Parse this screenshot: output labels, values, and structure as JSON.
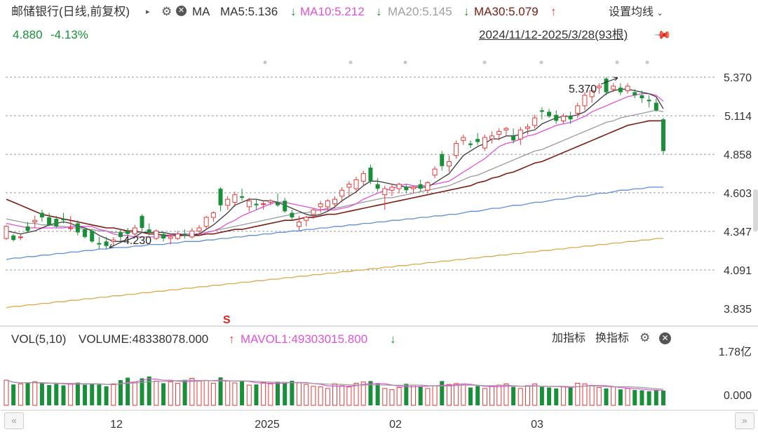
{
  "header": {
    "stock_name": "邮储银行",
    "period_mode": "(日线,前复权)",
    "ma_label": "MA",
    "ma5": "MA5:5.136",
    "ma10": "MA10:5.212",
    "ma20": "MA20:5.145",
    "ma30": "MA30:5.079",
    "settings_label": "设置均线",
    "price": "4.880",
    "change_pct": "-4.13%",
    "range_label": "2024/11/12-2025/3/28(93根)"
  },
  "volume_header": {
    "vol_label": "VOL(5,10)",
    "volume": "VOLUME:48338078.000",
    "mavol": "MAVOL1:49303015.800",
    "add_indicator": "加指标",
    "switch_indicator": "换指标"
  },
  "colors": {
    "up": "#e23a3a",
    "down": "#1a8f3a",
    "ma5": "#3a3a3a",
    "ma10": "#e052d6",
    "ma20": "#9a9a9a",
    "ma30": "#7a1a12",
    "ma60": "#5b8fd6",
    "ma120": "#d9a84a"
  },
  "chart_data": {
    "type": "candlestick",
    "price_axis_ticks": [
      "5.370",
      "5.114",
      "4.858",
      "4.603",
      "4.347",
      "4.091",
      "3.835"
    ],
    "price_range": [
      3.835,
      5.37
    ],
    "volume_axis_ticks": [
      "1.78亿",
      "0.000"
    ],
    "volume_max": 178000000,
    "x_labels": [
      "12",
      "2025",
      "02",
      "03"
    ],
    "annotations": {
      "high": "5.370",
      "low": "4.230"
    },
    "candles": [
      [
        4.3,
        4.39,
        4.29,
        4.38
      ],
      [
        4.32,
        4.33,
        4.28,
        4.29
      ],
      [
        4.31,
        4.33,
        4.29,
        4.31
      ],
      [
        4.38,
        4.41,
        4.34,
        4.35
      ],
      [
        4.41,
        4.45,
        4.37,
        4.42
      ],
      [
        4.47,
        4.49,
        4.41,
        4.44
      ],
      [
        4.44,
        4.47,
        4.38,
        4.39
      ],
      [
        4.43,
        4.45,
        4.37,
        4.38
      ],
      [
        4.43,
        4.47,
        4.4,
        4.42
      ],
      [
        4.37,
        4.45,
        4.35,
        4.37
      ],
      [
        4.4,
        4.42,
        4.32,
        4.34
      ],
      [
        4.36,
        4.37,
        4.3,
        4.31
      ],
      [
        4.35,
        4.36,
        4.27,
        4.28
      ],
      [
        4.27,
        4.31,
        4.23,
        4.26
      ],
      [
        4.28,
        4.31,
        4.23,
        4.25
      ],
      [
        4.28,
        4.31,
        4.25,
        4.29
      ],
      [
        4.34,
        4.36,
        4.28,
        4.31
      ],
      [
        4.35,
        4.37,
        4.29,
        4.33
      ],
      [
        4.33,
        4.39,
        4.31,
        4.37
      ],
      [
        4.45,
        4.46,
        4.35,
        4.37
      ],
      [
        4.36,
        4.4,
        4.32,
        4.34
      ],
      [
        4.3,
        4.36,
        4.29,
        4.35
      ],
      [
        4.33,
        4.34,
        4.28,
        4.3
      ],
      [
        4.3,
        4.33,
        4.26,
        4.31
      ],
      [
        4.3,
        4.35,
        4.29,
        4.33
      ],
      [
        4.33,
        4.36,
        4.3,
        4.32
      ],
      [
        4.31,
        4.37,
        4.3,
        4.35
      ],
      [
        4.35,
        4.39,
        4.32,
        4.37
      ],
      [
        4.38,
        4.45,
        4.36,
        4.44
      ],
      [
        4.44,
        4.48,
        4.41,
        4.47
      ],
      [
        4.63,
        4.64,
        4.48,
        4.52
      ],
      [
        4.52,
        4.58,
        4.49,
        4.56
      ],
      [
        4.54,
        4.61,
        4.51,
        4.59
      ],
      [
        4.58,
        4.63,
        4.55,
        4.57
      ],
      [
        4.51,
        4.57,
        4.48,
        4.55
      ],
      [
        4.53,
        4.56,
        4.49,
        4.52
      ],
      [
        4.53,
        4.55,
        4.49,
        4.53
      ],
      [
        4.54,
        4.56,
        4.52,
        4.55
      ],
      [
        4.54,
        4.6,
        4.51,
        4.52
      ],
      [
        4.55,
        4.57,
        4.47,
        4.48
      ],
      [
        4.47,
        4.49,
        4.42,
        4.44
      ],
      [
        4.38,
        4.45,
        4.35,
        4.41
      ],
      [
        4.42,
        4.45,
        4.38,
        4.44
      ],
      [
        4.46,
        4.5,
        4.43,
        4.49
      ],
      [
        4.51,
        4.55,
        4.47,
        4.53
      ],
      [
        4.51,
        4.56,
        4.48,
        4.55
      ],
      [
        4.53,
        4.58,
        4.5,
        4.56
      ],
      [
        4.58,
        4.64,
        4.54,
        4.62
      ],
      [
        4.64,
        4.68,
        4.58,
        4.66
      ],
      [
        4.63,
        4.71,
        4.6,
        4.69
      ],
      [
        4.68,
        4.75,
        4.65,
        4.73
      ],
      [
        4.77,
        4.79,
        4.66,
        4.68
      ],
      [
        4.66,
        4.7,
        4.61,
        4.63
      ],
      [
        4.59,
        4.65,
        4.49,
        4.63
      ],
      [
        4.62,
        4.66,
        4.58,
        4.64
      ],
      [
        4.63,
        4.67,
        4.6,
        4.66
      ],
      [
        4.64,
        4.66,
        4.6,
        4.62
      ],
      [
        4.63,
        4.65,
        4.6,
        4.64
      ],
      [
        4.66,
        4.69,
        4.61,
        4.63
      ],
      [
        4.62,
        4.68,
        4.6,
        4.67
      ],
      [
        4.72,
        4.78,
        4.7,
        4.76
      ],
      [
        4.86,
        4.88,
        4.75,
        4.78
      ],
      [
        4.78,
        4.85,
        4.74,
        4.81
      ],
      [
        4.85,
        4.95,
        4.83,
        4.93
      ],
      [
        4.95,
        4.99,
        4.92,
        4.97
      ],
      [
        4.93,
        4.95,
        4.9,
        4.92
      ],
      [
        4.96,
        5.0,
        4.92,
        4.94
      ],
      [
        4.9,
        4.99,
        4.88,
        4.97
      ],
      [
        4.96,
        5.01,
        4.93,
        4.98
      ],
      [
        4.99,
        5.03,
        4.95,
        5.01
      ],
      [
        5.02,
        5.04,
        4.98,
        5.03
      ],
      [
        4.98,
        5.03,
        4.93,
        4.95
      ],
      [
        4.96,
        5.04,
        4.92,
        5.02
      ],
      [
        5.03,
        5.06,
        4.99,
        5.04
      ],
      [
        5.05,
        5.12,
        5.03,
        5.1
      ],
      [
        5.15,
        5.17,
        5.09,
        5.14
      ],
      [
        5.14,
        5.16,
        5.1,
        5.11
      ],
      [
        5.12,
        5.15,
        5.06,
        5.08
      ],
      [
        5.08,
        5.13,
        5.06,
        5.11
      ],
      [
        5.11,
        5.14,
        5.06,
        5.09
      ],
      [
        5.13,
        5.2,
        5.1,
        5.18
      ],
      [
        5.18,
        5.27,
        5.15,
        5.25
      ],
      [
        5.24,
        5.3,
        5.2,
        5.28
      ],
      [
        5.3,
        5.33,
        5.26,
        5.31
      ],
      [
        5.36,
        5.37,
        5.25,
        5.27
      ],
      [
        5.29,
        5.33,
        5.27,
        5.31
      ],
      [
        5.3,
        5.33,
        5.25,
        5.27
      ],
      [
        5.28,
        5.33,
        5.26,
        5.31
      ],
      [
        5.27,
        5.29,
        5.23,
        5.25
      ],
      [
        5.25,
        5.28,
        5.2,
        5.23
      ],
      [
        5.22,
        5.25,
        5.17,
        5.21
      ],
      [
        5.2,
        5.23,
        5.14,
        5.15
      ],
      [
        5.09,
        5.1,
        4.86,
        4.88
      ]
    ],
    "volumes": [
      82,
      68,
      70,
      74,
      77,
      72,
      66,
      70,
      65,
      71,
      74,
      67,
      69,
      68,
      62,
      70,
      82,
      90,
      76,
      88,
      94,
      79,
      72,
      77,
      72,
      83,
      88,
      79,
      81,
      72,
      91,
      79,
      73,
      81,
      66,
      68,
      74,
      70,
      77,
      72,
      80,
      73,
      68,
      62,
      60,
      55,
      70,
      64,
      60,
      72,
      76,
      79,
      70,
      55,
      51,
      58,
      70,
      66,
      62,
      55,
      64,
      79,
      68,
      71,
      66,
      58,
      63,
      55,
      61,
      66,
      70,
      60,
      55,
      64,
      70,
      60,
      58,
      55,
      60,
      58,
      72,
      70,
      64,
      58,
      55,
      60,
      52,
      55,
      50,
      49,
      46,
      49,
      48
    ],
    "ma_series": {
      "ma5": [
        4.35,
        4.34,
        4.33,
        4.34,
        4.35,
        4.37,
        4.39,
        4.4,
        4.41,
        4.4,
        4.38,
        4.37,
        4.35,
        4.32,
        4.3,
        4.28,
        4.28,
        4.29,
        4.31,
        4.34,
        4.34,
        4.34,
        4.34,
        4.33,
        4.33,
        4.32,
        4.32,
        4.33,
        4.36,
        4.39,
        4.43,
        4.47,
        4.52,
        4.54,
        4.56,
        4.56,
        4.55,
        4.55,
        4.54,
        4.52,
        4.5,
        4.48,
        4.46,
        4.45,
        4.46,
        4.48,
        4.51,
        4.55,
        4.58,
        4.61,
        4.65,
        4.68,
        4.68,
        4.67,
        4.66,
        4.65,
        4.64,
        4.64,
        4.64,
        4.64,
        4.67,
        4.7,
        4.73,
        4.79,
        4.85,
        4.88,
        4.91,
        4.93,
        4.96,
        4.96,
        4.98,
        4.98,
        4.99,
        5.01,
        5.02,
        5.06,
        5.08,
        5.1,
        5.11,
        5.11,
        5.12,
        5.14,
        5.18,
        5.22,
        5.26,
        5.28,
        5.29,
        5.29,
        5.28,
        5.27,
        5.26,
        5.24,
        5.16
      ],
      "ma10": [
        4.4,
        4.39,
        4.38,
        4.37,
        4.37,
        4.37,
        4.37,
        4.37,
        4.37,
        4.38,
        4.38,
        4.38,
        4.38,
        4.36,
        4.35,
        4.33,
        4.32,
        4.32,
        4.31,
        4.31,
        4.31,
        4.31,
        4.31,
        4.32,
        4.33,
        4.33,
        4.33,
        4.33,
        4.34,
        4.35,
        4.37,
        4.4,
        4.42,
        4.45,
        4.47,
        4.49,
        4.51,
        4.53,
        4.54,
        4.54,
        4.53,
        4.52,
        4.51,
        4.5,
        4.49,
        4.49,
        4.49,
        4.5,
        4.51,
        4.53,
        4.56,
        4.58,
        4.6,
        4.62,
        4.63,
        4.65,
        4.66,
        4.65,
        4.65,
        4.65,
        4.66,
        4.67,
        4.68,
        4.71,
        4.74,
        4.77,
        4.8,
        4.83,
        4.87,
        4.91,
        4.93,
        4.94,
        4.96,
        4.98,
        4.99,
        5.01,
        5.03,
        5.05,
        5.06,
        5.07,
        5.09,
        5.11,
        5.14,
        5.16,
        5.18,
        5.2,
        5.22,
        5.24,
        5.25,
        5.26,
        5.26,
        5.25,
        5.21
      ],
      "ma20": [
        4.43,
        4.42,
        4.41,
        4.4,
        4.4,
        4.39,
        4.39,
        4.38,
        4.38,
        4.37,
        4.37,
        4.36,
        4.36,
        4.35,
        4.35,
        4.34,
        4.34,
        4.34,
        4.34,
        4.34,
        4.34,
        4.34,
        4.34,
        4.33,
        4.33,
        4.33,
        4.33,
        4.33,
        4.34,
        4.35,
        4.36,
        4.37,
        4.38,
        4.39,
        4.4,
        4.41,
        4.42,
        4.43,
        4.44,
        4.45,
        4.46,
        4.47,
        4.47,
        4.48,
        4.49,
        4.5,
        4.5,
        4.51,
        4.52,
        4.53,
        4.54,
        4.55,
        4.56,
        4.57,
        4.57,
        4.58,
        4.59,
        4.6,
        4.61,
        4.62,
        4.63,
        4.64,
        4.65,
        4.67,
        4.69,
        4.71,
        4.72,
        4.74,
        4.76,
        4.78,
        4.8,
        4.82,
        4.84,
        4.86,
        4.88,
        4.89,
        4.91,
        4.93,
        4.95,
        4.97,
        4.99,
        5.01,
        5.03,
        5.05,
        5.07,
        5.08,
        5.1,
        5.11,
        5.12,
        5.13,
        5.14,
        5.15,
        5.14
      ],
      "ma30": [
        4.56,
        4.54,
        4.52,
        4.5,
        4.48,
        4.46,
        4.45,
        4.44,
        4.43,
        4.42,
        4.41,
        4.4,
        4.39,
        4.38,
        4.37,
        4.37,
        4.36,
        4.35,
        4.35,
        4.34,
        4.33,
        4.33,
        4.32,
        4.32,
        4.32,
        4.32,
        4.32,
        4.32,
        4.33,
        4.33,
        4.34,
        4.35,
        4.36,
        4.36,
        4.37,
        4.38,
        4.39,
        4.4,
        4.41,
        4.42,
        4.42,
        4.43,
        4.44,
        4.44,
        4.45,
        4.46,
        4.46,
        4.47,
        4.48,
        4.49,
        4.5,
        4.51,
        4.52,
        4.53,
        4.54,
        4.55,
        4.56,
        4.57,
        4.58,
        4.59,
        4.6,
        4.61,
        4.62,
        4.63,
        4.64,
        4.65,
        4.67,
        4.68,
        4.7,
        4.71,
        4.73,
        4.74,
        4.76,
        4.78,
        4.8,
        4.81,
        4.83,
        4.85,
        4.87,
        4.89,
        4.91,
        4.93,
        4.95,
        4.97,
        4.99,
        5.01,
        5.03,
        5.05,
        5.06,
        5.07,
        5.08,
        5.08,
        5.08
      ],
      "ma60": [
        4.16,
        4.17,
        4.17,
        4.18,
        4.18,
        4.19,
        4.19,
        4.2,
        4.2,
        4.21,
        4.21,
        4.22,
        4.22,
        4.23,
        4.23,
        4.24,
        4.24,
        4.24,
        4.25,
        4.25,
        4.26,
        4.26,
        4.26,
        4.27,
        4.27,
        4.28,
        4.28,
        4.28,
        4.29,
        4.29,
        4.3,
        4.3,
        4.31,
        4.31,
        4.32,
        4.32,
        4.33,
        4.33,
        4.34,
        4.34,
        4.35,
        4.35,
        4.36,
        4.36,
        4.37,
        4.37,
        4.38,
        4.38,
        4.39,
        4.39,
        4.4,
        4.4,
        4.41,
        4.41,
        4.42,
        4.42,
        4.43,
        4.43,
        4.44,
        4.44,
        4.45,
        4.45,
        4.46,
        4.46,
        4.47,
        4.48,
        4.48,
        4.49,
        4.5,
        4.5,
        4.51,
        4.52,
        4.52,
        4.53,
        4.54,
        4.54,
        4.55,
        4.56,
        4.56,
        4.57,
        4.58,
        4.58,
        4.59,
        4.6,
        4.6,
        4.61,
        4.62,
        4.62,
        4.63,
        4.63,
        4.64,
        4.64,
        4.64
      ],
      "ma120": [
        3.84,
        3.85,
        3.85,
        3.86,
        3.86,
        3.87,
        3.87,
        3.88,
        3.88,
        3.89,
        3.89,
        3.9,
        3.9,
        3.91,
        3.91,
        3.92,
        3.92,
        3.93,
        3.93,
        3.94,
        3.94,
        3.95,
        3.95,
        3.96,
        3.96,
        3.97,
        3.97,
        3.98,
        3.98,
        3.99,
        3.99,
        4.0,
        4.0,
        4.01,
        4.01,
        4.02,
        4.02,
        4.03,
        4.03,
        4.04,
        4.04,
        4.05,
        4.05,
        4.06,
        4.06,
        4.07,
        4.07,
        4.08,
        4.08,
        4.09,
        4.09,
        4.1,
        4.1,
        4.11,
        4.11,
        4.12,
        4.12,
        4.13,
        4.13,
        4.14,
        4.14,
        4.15,
        4.15,
        4.16,
        4.16,
        4.17,
        4.17,
        4.18,
        4.18,
        4.19,
        4.19,
        4.2,
        4.2,
        4.21,
        4.21,
        4.22,
        4.22,
        4.23,
        4.23,
        4.24,
        4.24,
        4.25,
        4.25,
        4.26,
        4.26,
        4.27,
        4.27,
        4.28,
        4.28,
        4.29,
        4.29,
        4.3,
        4.3
      ]
    }
  }
}
